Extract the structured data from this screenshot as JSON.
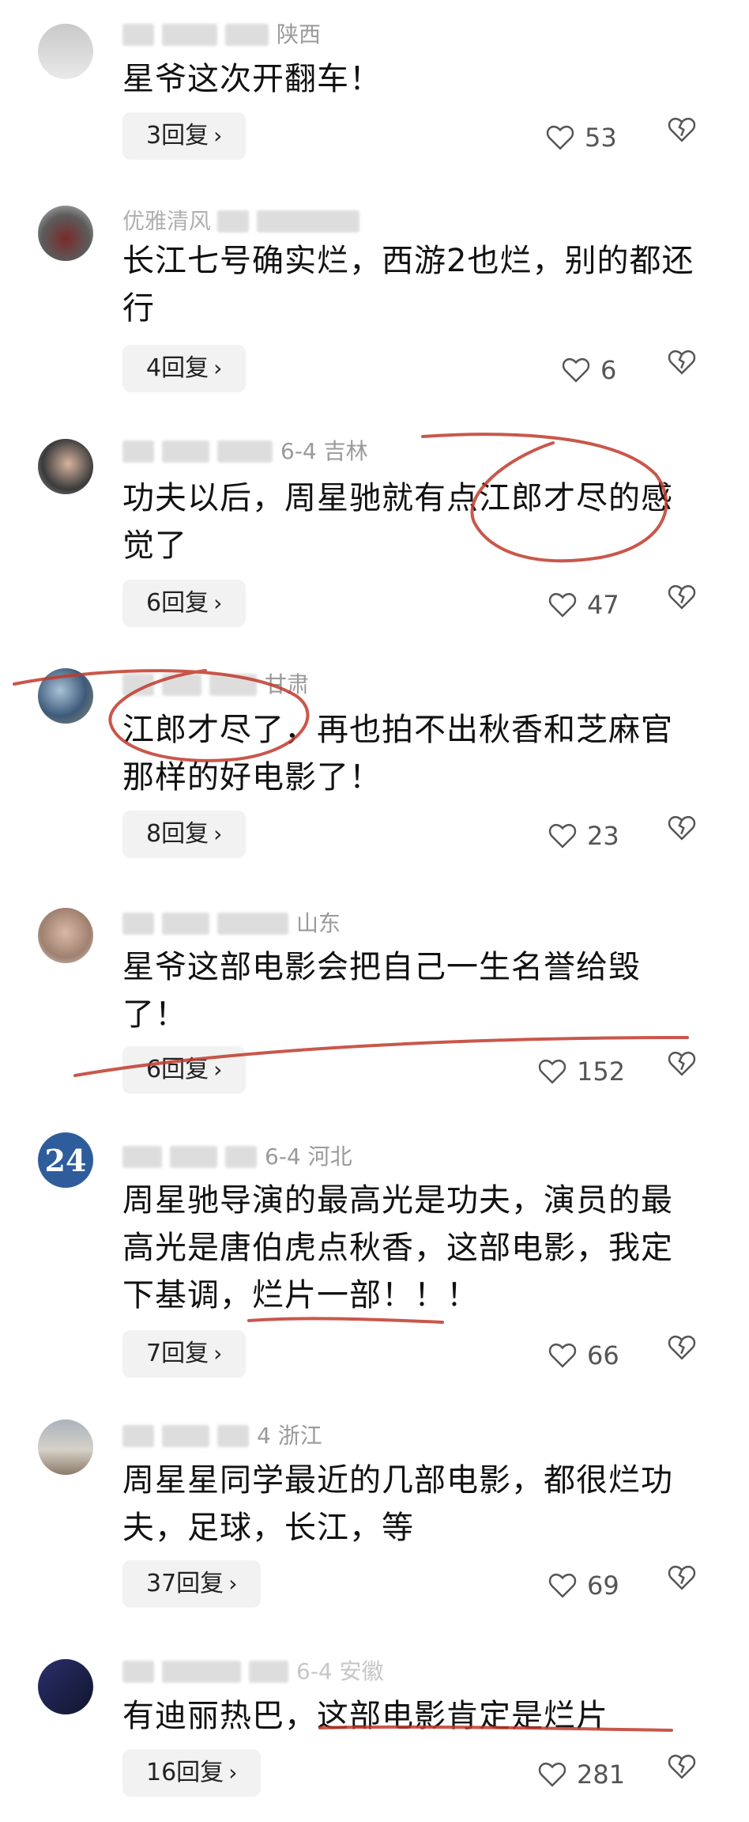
{
  "comments": [
    {
      "location": "陕西",
      "text": "星爷这次开翻车！",
      "reply": "3回复",
      "likes": "53"
    },
    {
      "location": "",
      "text": "长江七号确实烂，西游2也烂，别的都还行",
      "reply": "4回复",
      "likes": "6",
      "user_partial": "优雅清风"
    },
    {
      "location": "6-4  吉林",
      "text": "功夫以后，周星驰就有点江郎才尽的感觉了",
      "reply": "6回复",
      "likes": "47"
    },
    {
      "location": "甘肃",
      "text": "江郎才尽了，再也拍不出秋香和芝麻官那样的好电影了！",
      "reply": "8回复",
      "likes": "23"
    },
    {
      "location": "山东",
      "text": "星爷这部电影会把自己一生名誉给毁了！",
      "reply": "6回复",
      "likes": "152"
    },
    {
      "location": "6-4  河北",
      "text": "周星驰导演的最高光是功夫，演员的最高光是唐伯虎点秋香，这部电影，我定下基调，烂片一部！！！",
      "reply": "7回复",
      "likes": "66",
      "avatar_text": "24"
    },
    {
      "location": "4  浙江",
      "text": "周星星同学最近的几部电影，都很烂功夫，足球，长江，等",
      "reply": "37回复",
      "likes": "69"
    },
    {
      "location": "6-4  安徽",
      "text": "有迪丽热巴，这部电影肯定是烂片",
      "reply": "16回复",
      "likes": "281"
    }
  ],
  "colors": {
    "annotation": "#c0392b",
    "reply_bg": "#f2f2f2",
    "meta": "#9a9a9a"
  },
  "icons": {
    "like": "heart-icon",
    "dislike": "broken-heart-icon",
    "chevron": "chevron-right-icon"
  }
}
